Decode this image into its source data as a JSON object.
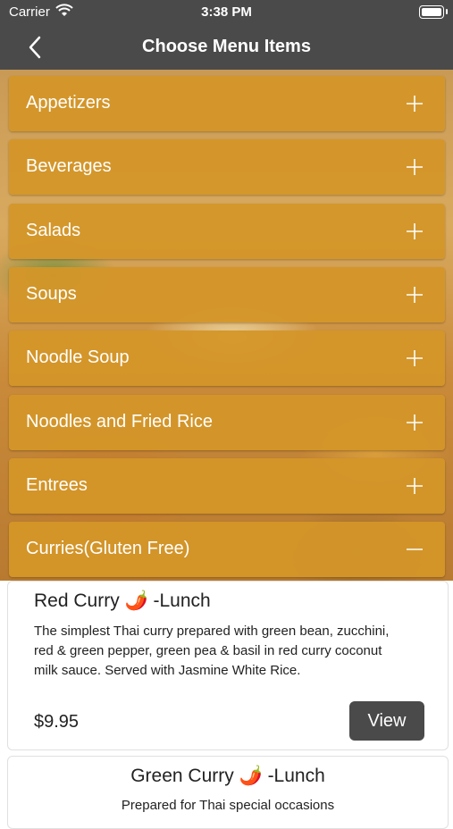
{
  "status_bar": {
    "carrier": "Carrier",
    "time": "3:38 PM"
  },
  "nav": {
    "title": "Choose Menu Items"
  },
  "categories": [
    {
      "label": "Appetizers",
      "state": "+"
    },
    {
      "label": "Beverages",
      "state": "+"
    },
    {
      "label": "Salads",
      "state": "+"
    },
    {
      "label": "Soups",
      "state": "+"
    },
    {
      "label": "Noodle Soup",
      "state": "+"
    },
    {
      "label": "Noodles and Fried Rice",
      "state": "+"
    },
    {
      "label": "Entrees",
      "state": "+"
    },
    {
      "label": "Curries(Gluten Free)",
      "state": "−"
    }
  ],
  "items": [
    {
      "name": "Red Curry 🌶️ -Lunch",
      "description": "The simplest Thai curry prepared with green bean, zucchini, red & green pepper, green pea & basil in red curry coconut milk sauce. Served with Jasmine White Rice.",
      "price": "$9.95",
      "button": "View"
    },
    {
      "name": "Green Curry 🌶️ -Lunch",
      "description": "Prepared for Thai special occasions"
    }
  ],
  "colors": {
    "category_bg": "#d4962a",
    "bar_bg": "#4a4a4a",
    "button_bg": "#4a4a4a"
  }
}
